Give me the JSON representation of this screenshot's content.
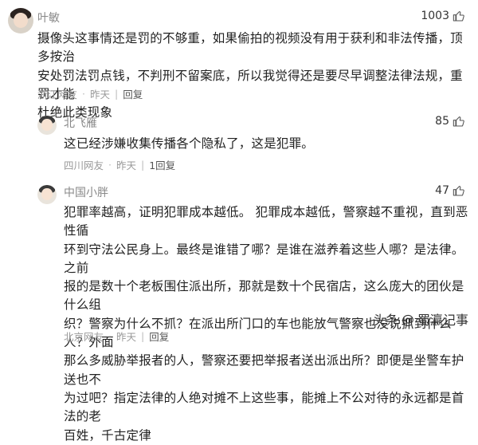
{
  "comments": [
    {
      "user": "叶敏",
      "likes": "1003",
      "text": [
        "摄像头这事情还是罚的不够重，如果偷拍的视频没有用于获利和非法传播，顶多按治",
        "安处罚法罚点钱，不判刑不留案底，所以我觉得还是要尽早调整法律法规，重罚才能",
        "杜绝此类现象"
      ],
      "location": "浙江网友",
      "time": "昨天",
      "reply": "回复"
    },
    {
      "user": "北飞雁",
      "likes": "85",
      "text": [
        "这已经涉嫌收集传播各个隐私了，这是犯罪。"
      ],
      "location": "四川网友",
      "time": "昨天",
      "reply": "1回复"
    },
    {
      "user": "中国小胖",
      "likes": "47",
      "text": [
        "犯罪率越高，证明犯罪成本越低。 犯罪成本越低，警察越不重视，直到恶性循",
        "环到守法公民身上。最终是谁错了哪？是谁在滋养着这些人哪？是法律。 之前",
        "报的是数十个老板围住派出所，那就是数十个民宿店，这么庞大的团伙是什么组",
        "织？警察为什么不抓？在派出所门口的车也能放气警察也没说抓到什么人？外面",
        "那么多威胁举报者的人，警察还要把举报者送出派出所？即便是坐警车护送也不",
        "为过吧？指定法律的人绝对摊不上这些事，能摊上不公对待的永远都是首法的老",
        "百姓，千古定律"
      ],
      "location": "北京网友",
      "time": "昨天",
      "reply": "回复"
    }
  ],
  "watermark": {
    "brand": "头条",
    "at": "@",
    "author": "蜀瀛记事"
  },
  "colors": {
    "muted": "#999999",
    "text": "#222222",
    "username": "#888888"
  }
}
